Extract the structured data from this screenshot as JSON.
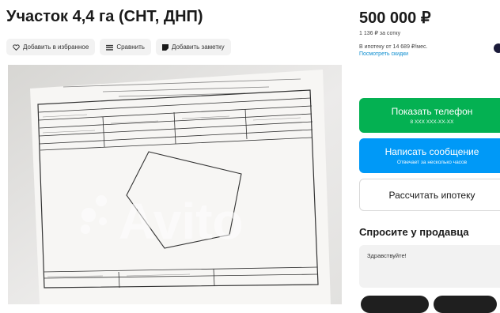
{
  "listing": {
    "title": "Участок 4,4 га (СНТ, ДНП)"
  },
  "actions": [
    {
      "label": "Добавить в избранное",
      "icon": "heart-icon"
    },
    {
      "label": "Сравнить",
      "icon": "compare-icon"
    },
    {
      "label": "Добавить заметку",
      "icon": "note-icon"
    }
  ],
  "photo": {
    "watermark": "Avito"
  },
  "sidebar": {
    "price": "500 000 ₽",
    "per_unit": "1 136 ₽ за сотку",
    "mortgage_line": "В ипотеку от 14 689 ₽/мес.",
    "discount_link": "Посмотреть скидки",
    "phone_button": "Показать телефон",
    "phone_sub": "8 XXX XXX-XX-XX",
    "message_button": "Написать сообщение",
    "message_sub": "Отвечает за несколько часов",
    "mortgage_button": "Рассчитать ипотеку",
    "ask_title": "Спросите у продавца",
    "ask_input_value": "Здравствуйте!"
  },
  "colors": {
    "green": "#04b152",
    "blue": "#0099f7",
    "link": "#0a8ccf"
  }
}
